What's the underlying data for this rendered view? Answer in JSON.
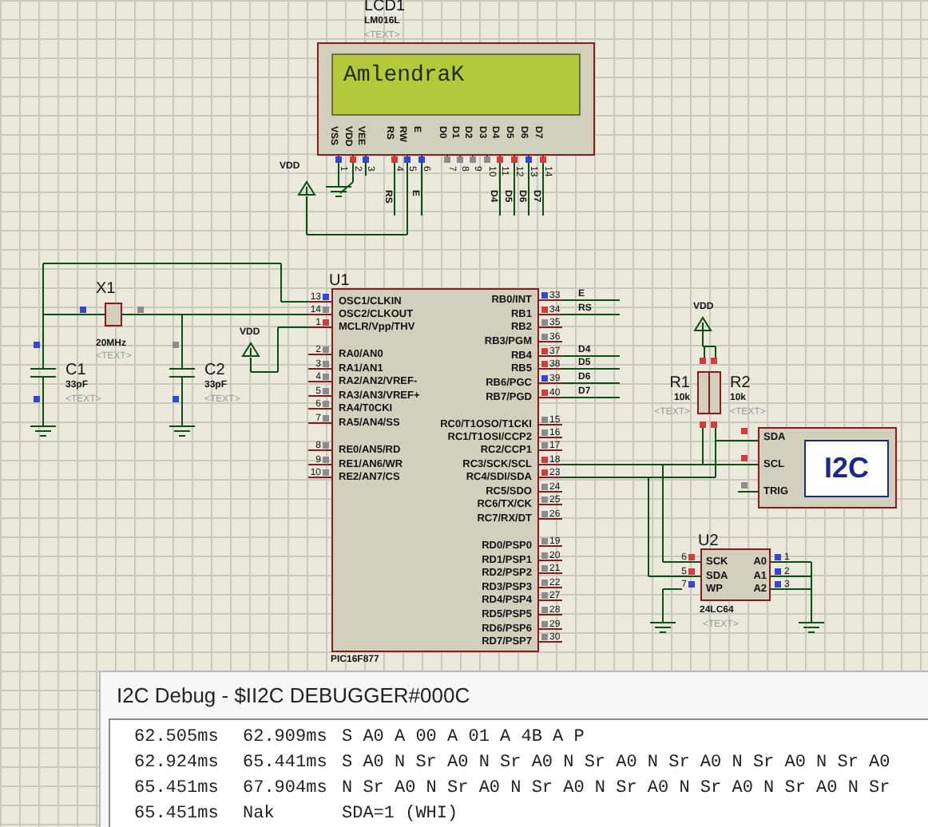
{
  "lcd": {
    "ref": "LCD1",
    "part": "LM016L",
    "text": "<TEXT>",
    "display": "AmlendraK",
    "vdd": "VDD",
    "pins": [
      {
        "label": "VSS",
        "number": "1",
        "color": "#3348cc"
      },
      {
        "label": "VDD",
        "number": "2",
        "color": "#d23c3c"
      },
      {
        "label": "VEE",
        "number": "3",
        "color": "#3348cc"
      },
      {
        "label": "RS",
        "number": "4",
        "color": "#d23c3c"
      },
      {
        "label": "RW",
        "number": "5",
        "color": "#3348cc"
      },
      {
        "label": "E",
        "number": "6",
        "color": "#3348cc"
      },
      {
        "label": "D0",
        "number": "7",
        "color": "#8c8c8c"
      },
      {
        "label": "D1",
        "number": "8",
        "color": "#8c8c8c"
      },
      {
        "label": "D2",
        "number": "9",
        "color": "#8c8c8c"
      },
      {
        "label": "D3",
        "number": "10",
        "color": "#8c8c8c"
      },
      {
        "label": "D4",
        "number": "11",
        "color": "#d23c3c"
      },
      {
        "label": "D5",
        "number": "12",
        "color": "#d23c3c"
      },
      {
        "label": "D6",
        "number": "13",
        "color": "#3348cc"
      },
      {
        "label": "D7",
        "number": "14",
        "color": "#d23c3c"
      }
    ],
    "nets": [
      "RS",
      "E",
      "D4",
      "D5",
      "D6",
      "D7"
    ]
  },
  "crystal": {
    "ref": "X1",
    "value": "20MHz",
    "text": "<TEXT>",
    "pins": [
      {
        "color": "#3348cc"
      },
      {
        "color": "#8c8c8c"
      }
    ]
  },
  "capacitors": [
    {
      "ref": "C1",
      "value": "33pF",
      "text": "<TEXT>",
      "pins": [
        {
          "color": "#3348cc"
        },
        {
          "color": "#3348cc"
        }
      ]
    },
    {
      "ref": "C2",
      "value": "33pF",
      "text": "<TEXT>",
      "pins": [
        {
          "color": "#8c8c8c"
        },
        {
          "color": "#3348cc"
        }
      ]
    }
  ],
  "mcu_vdd": "VDD",
  "mcu": {
    "ref": "U1",
    "part": "PIC16F877",
    "left_pins": [
      {
        "label": "OSC1/CLKIN",
        "number": "13",
        "color": "#3348cc"
      },
      {
        "label": "OSC2/CLKOUT",
        "number": "14",
        "color": "#8c8c8c"
      },
      {
        "label": "MCLR/Vpp/THV",
        "number": "1",
        "color": "#d23c3c"
      },
      {
        "label": "RA0/AN0",
        "number": "2",
        "color": "#8c8c8c"
      },
      {
        "label": "RA1/AN1",
        "number": "3",
        "color": "#8c8c8c"
      },
      {
        "label": "RA2/AN2/VREF-",
        "number": "4",
        "color": "#8c8c8c"
      },
      {
        "label": "RA3/AN3/VREF+",
        "number": "5",
        "color": "#8c8c8c"
      },
      {
        "label": "RA4/T0CKI",
        "number": "6",
        "color": "#8c8c8c"
      },
      {
        "label": "RA5/AN4/SS",
        "number": "7",
        "color": "#8c8c8c"
      },
      {
        "label": "RE0/AN5/RD",
        "number": "8",
        "color": "#8c8c8c"
      },
      {
        "label": "RE1/AN6/WR",
        "number": "9",
        "color": "#8c8c8c"
      },
      {
        "label": "RE2/AN7/CS",
        "number": "10",
        "color": "#8c8c8c"
      }
    ],
    "right_pins": [
      {
        "label": "RB0/INT",
        "number": "33",
        "color": "#3348cc",
        "net": "E"
      },
      {
        "label": "RB1",
        "number": "34",
        "color": "#d23c3c",
        "net": "RS"
      },
      {
        "label": "RB2",
        "number": "35",
        "color": "#8c8c8c"
      },
      {
        "label": "RB3/PGM",
        "number": "36",
        "color": "#8c8c8c"
      },
      {
        "label": "RB4",
        "number": "37",
        "color": "#d23c3c",
        "net": "D4"
      },
      {
        "label": "RB5",
        "number": "38",
        "color": "#d23c3c",
        "net": "D5"
      },
      {
        "label": "RB6/PGC",
        "number": "39",
        "color": "#3348cc",
        "net": "D6"
      },
      {
        "label": "RB7/PGD",
        "number": "40",
        "color": "#d23c3c",
        "net": "D7"
      },
      {
        "label": "RC0/T1OSO/T1CKI",
        "number": "15",
        "color": "#8c8c8c"
      },
      {
        "label": "RC1/T1OSI/CCP2",
        "number": "16",
        "color": "#8c8c8c"
      },
      {
        "label": "RC2/CCP1",
        "number": "17",
        "color": "#8c8c8c"
      },
      {
        "label": "RC3/SCK/SCL",
        "number": "18",
        "color": "#d23c3c"
      },
      {
        "label": "RC4/SDI/SDA",
        "number": "23",
        "color": "#d23c3c"
      },
      {
        "label": "RC5/SDO",
        "number": "24",
        "color": "#8c8c8c"
      },
      {
        "label": "RC6/TX/CK",
        "number": "25",
        "color": "#8c8c8c"
      },
      {
        "label": "RC7/RX/DT",
        "number": "26",
        "color": "#8c8c8c"
      },
      {
        "label": "RD0/PSP0",
        "number": "19",
        "color": "#8c8c8c"
      },
      {
        "label": "RD1/PSP1",
        "number": "20",
        "color": "#8c8c8c"
      },
      {
        "label": "RD2/PSP2",
        "number": "21",
        "color": "#8c8c8c"
      },
      {
        "label": "RD3/PSP3",
        "number": "22",
        "color": "#8c8c8c"
      },
      {
        "label": "RD4/PSP4",
        "number": "27",
        "color": "#8c8c8c"
      },
      {
        "label": "RD5/PSP5",
        "number": "28",
        "color": "#8c8c8c"
      },
      {
        "label": "RD6/PSP6",
        "number": "29",
        "color": "#8c8c8c"
      },
      {
        "label": "RD7/PSP7",
        "number": "30",
        "color": "#8c8c8c"
      }
    ]
  },
  "pullup_vdd": "VDD",
  "resistors": [
    {
      "ref": "R1",
      "value": "10k",
      "text": "<TEXT>",
      "pins": [
        {
          "color": "#d23c3c"
        },
        {
          "color": "#d23c3c"
        }
      ]
    },
    {
      "ref": "R2",
      "value": "10k",
      "text": "<TEXT>",
      "pins": [
        {
          "color": "#d23c3c"
        },
        {
          "color": "#d23c3c"
        }
      ]
    }
  ],
  "i2c_debugger": {
    "title": "I2C",
    "pins": [
      {
        "label": "SDA",
        "color": "#d23c3c"
      },
      {
        "label": "SCL",
        "color": "#d23c3c"
      },
      {
        "label": "TRIG",
        "color": "#8c8c8c"
      }
    ]
  },
  "eeprom": {
    "ref": "U2",
    "part": "24LC64",
    "text": "<TEXT>",
    "left_pins": [
      {
        "label": "SCK",
        "number": "6",
        "color": "#d23c3c"
      },
      {
        "label": "SDA",
        "number": "5",
        "color": "#d23c3c"
      },
      {
        "label": "WP",
        "number": "7",
        "color": "#3348cc"
      }
    ],
    "right_pins": [
      {
        "label": "A0",
        "number": "1",
        "color": "#3348cc"
      },
      {
        "label": "A1",
        "number": "2",
        "color": "#3348cc"
      },
      {
        "label": "A2",
        "number": "3",
        "color": "#3348cc"
      }
    ]
  },
  "debug_window": {
    "title": "I2C Debug - $II2C DEBUGGER#000C",
    "lines": [
      {
        "start": "62.505ms",
        "end": "62.909ms",
        "data": "S A0 A 00 A 01 A 4B A P"
      },
      {
        "start": "62.924ms",
        "end": "65.441ms",
        "data": "S A0 N Sr A0 N Sr A0 N Sr A0 N Sr A0 N Sr A0 N Sr A0"
      },
      {
        "start": "65.451ms",
        "end": "67.904ms",
        "data": "N Sr A0 N Sr A0 N Sr A0 N Sr A0 N Sr A0 N Sr A0 N Sr"
      },
      {
        "start": "65.451ms",
        "end": "Nak",
        "data": "SDA=1 (WHI)"
      }
    ]
  }
}
